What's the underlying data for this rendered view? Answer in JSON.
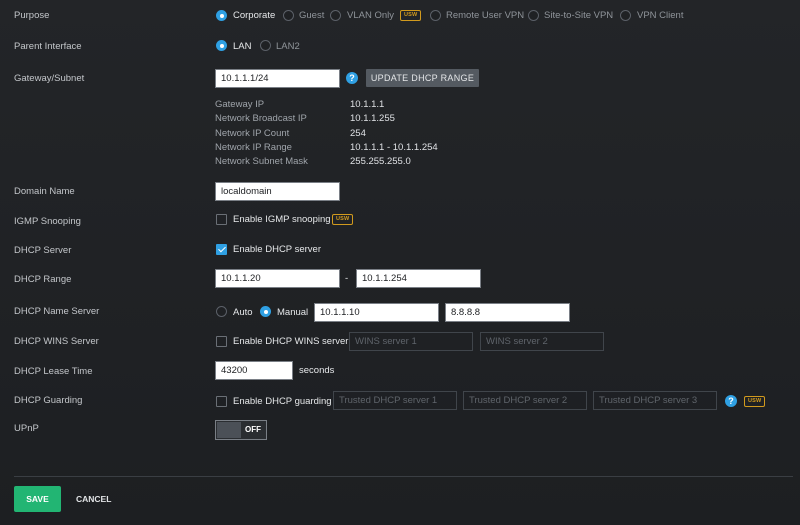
{
  "labels": {
    "purpose": "Purpose",
    "parent_interface": "Parent Interface",
    "gateway_subnet": "Gateway/Subnet",
    "domain_name": "Domain Name",
    "igmp_snooping": "IGMP Snooping",
    "dhcp_server": "DHCP Server",
    "dhcp_range": "DHCP Range",
    "dhcp_name_server": "DHCP Name Server",
    "dhcp_wins_server": "DHCP WINS Server",
    "dhcp_lease_time": "DHCP Lease Time",
    "dhcp_guarding": "DHCP Guarding",
    "upnp": "UPnP"
  },
  "purpose": {
    "options": [
      "Corporate",
      "Guest",
      "VLAN Only",
      "Remote User VPN",
      "Site-to-Site VPN",
      "VPN Client"
    ],
    "selected": "Corporate",
    "vlan_badge": "USW"
  },
  "parent_interface": {
    "options": [
      "LAN",
      "LAN2"
    ],
    "selected": "LAN"
  },
  "gateway": {
    "value": "10.1.1.1/24",
    "help": "?",
    "update_button": "UPDATE DHCP RANGE",
    "info": [
      {
        "key": "Gateway IP",
        "value": "10.1.1.1"
      },
      {
        "key": "Network Broadcast IP",
        "value": "10.1.1.255"
      },
      {
        "key": "Network IP Count",
        "value": "254"
      },
      {
        "key": "Network IP Range",
        "value": "10.1.1.1 - 10.1.1.254"
      },
      {
        "key": "Network Subnet Mask",
        "value": "255.255.255.0"
      }
    ]
  },
  "domain_name": {
    "value": "localdomain"
  },
  "igmp": {
    "label": "Enable IGMP snooping",
    "checked": false,
    "badge": "USW"
  },
  "dhcp_server": {
    "label": "Enable DHCP server",
    "checked": true
  },
  "dhcp_range": {
    "start": "10.1.1.20",
    "separator": "-",
    "end": "10.1.1.254"
  },
  "dhcp_name_server": {
    "auto_label": "Auto",
    "manual_label": "Manual",
    "selected": "Manual",
    "server1": "10.1.1.10",
    "server2": "8.8.8.8"
  },
  "dhcp_wins": {
    "label": "Enable DHCP WINS server",
    "checked": false,
    "placeholder1": "WINS server 1",
    "placeholder2": "WINS server 2"
  },
  "dhcp_lease": {
    "value": "43200",
    "unit": "seconds"
  },
  "dhcp_guarding": {
    "label": "Enable DHCP guarding",
    "checked": false,
    "placeholder1": "Trusted DHCP server 1",
    "placeholder2": "Trusted DHCP server 2",
    "placeholder3": "Trusted DHCP server 3",
    "help": "?",
    "badge": "USW"
  },
  "upnp": {
    "state": "OFF"
  },
  "footer": {
    "save": "SAVE",
    "cancel": "CANCEL"
  },
  "colors": {
    "accent": "#2fa0e3",
    "save": "#22b573",
    "badge": "#d19a1e"
  }
}
